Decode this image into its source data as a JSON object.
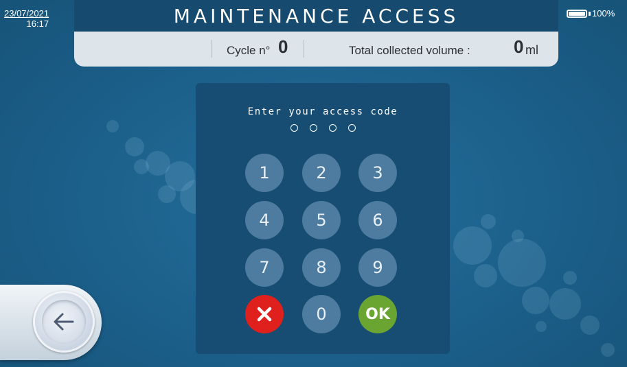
{
  "status": {
    "date": "23/07/2021",
    "time": "16:17",
    "battery_percent_label": "100%",
    "battery_level": 1.0
  },
  "header": {
    "title": "MAINTENANCE ACCESS"
  },
  "info": {
    "cycle_label": "Cycle n°",
    "cycle_value": "0",
    "volume_label": "Total collected volume :",
    "volume_value": "0",
    "volume_unit": "ml"
  },
  "keypad": {
    "prompt": "Enter your access code",
    "code_length": 4,
    "keys": [
      "1",
      "2",
      "3",
      "4",
      "5",
      "6",
      "7",
      "8",
      "9"
    ],
    "zero": "0",
    "ok": "OK",
    "cancel_icon": "close-icon"
  },
  "navigation": {
    "back_icon": "arrow-left-icon"
  },
  "colors": {
    "background": "#1b5f8a",
    "header": "#164a6e",
    "info_bar": "#dde4ea",
    "panel": "#174d72",
    "key": "#4d7ca0",
    "cancel": "#e0201c",
    "ok": "#6aa531"
  }
}
